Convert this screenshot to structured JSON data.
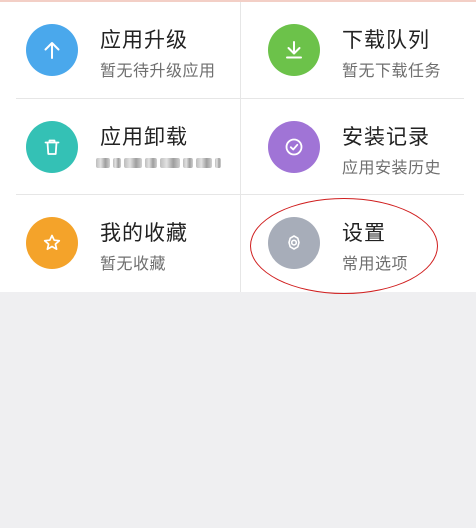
{
  "menu": {
    "items": [
      {
        "title": "应用升级",
        "subtitle": "暂无待升级应用",
        "icon": "arrow-up-icon",
        "color": "#4aa8ec"
      },
      {
        "title": "下载队列",
        "subtitle": "暂无下载任务",
        "icon": "download-icon",
        "color": "#6cc24a"
      },
      {
        "title": "应用卸载",
        "subtitle": "",
        "icon": "trash-icon",
        "color": "#34c1b5"
      },
      {
        "title": "安装记录",
        "subtitle": "应用安装历史",
        "icon": "check-circle-icon",
        "color": "#a074d6"
      },
      {
        "title": "我的收藏",
        "subtitle": "暂无收藏",
        "icon": "star-icon",
        "color": "#f4a32a"
      },
      {
        "title": "设置",
        "subtitle": "常用选项",
        "icon": "gear-icon",
        "color": "#a7adb9"
      }
    ]
  }
}
